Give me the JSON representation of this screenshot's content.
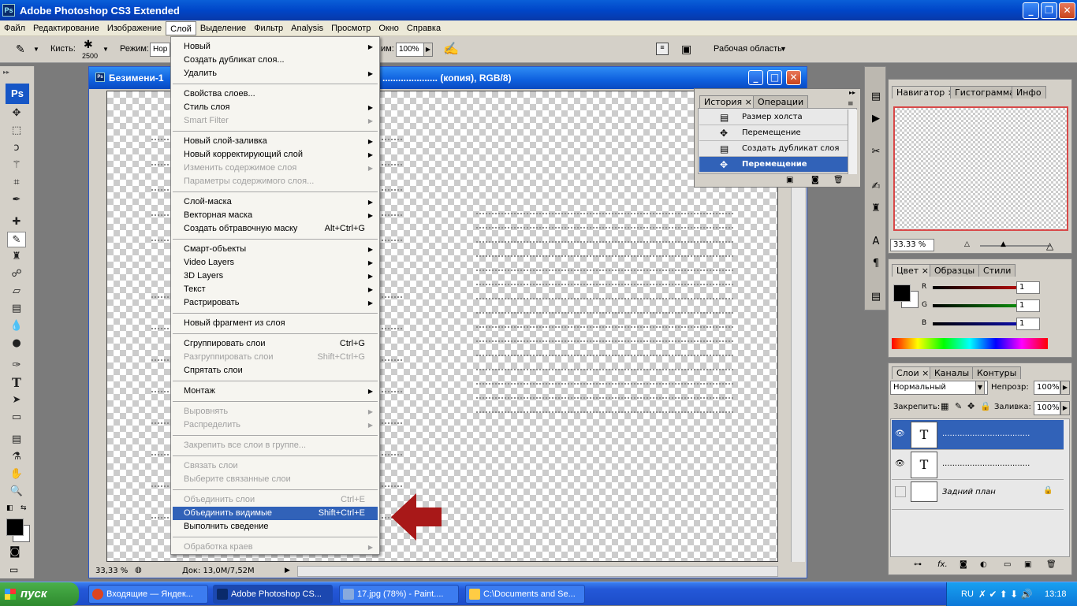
{
  "app": {
    "title": "Adobe Photoshop CS3 Extended",
    "icon": "Ps"
  },
  "menubar": [
    "Файл",
    "Редактирование",
    "Изображение",
    "Слой",
    "Выделение",
    "Фильтр",
    "Analysis",
    "Просмотр",
    "Окно",
    "Справка"
  ],
  "options": {
    "brush_label": "Кисть:",
    "brush_size": "2500",
    "mode_label": "Режим:",
    "mode_value": "Нор",
    "flow_suffix": "им:",
    "zoom_value": "100%",
    "workspace": "Рабочая область"
  },
  "document": {
    "title_left": "Безимени-1",
    "title_right": "..................... (копия), RGB/8)",
    "zoom": "33,33 %",
    "doc_size": "Док: 13,0M/7,52M"
  },
  "layer_menu": [
    {
      "label": "Новый",
      "sub": true
    },
    {
      "label": "Создать дубликат слоя..."
    },
    {
      "label": "Удалить",
      "sub": true
    },
    {
      "sep": true
    },
    {
      "label": "Свойства слоев..."
    },
    {
      "label": "Стиль слоя",
      "sub": true
    },
    {
      "label": "Smart Filter",
      "sub": true,
      "disabled": true
    },
    {
      "sep": true
    },
    {
      "label": "Новый слой-заливка",
      "sub": true
    },
    {
      "label": "Новый корректирующий слой",
      "sub": true
    },
    {
      "label": "Изменить содержимое слоя",
      "sub": true,
      "disabled": true
    },
    {
      "label": "Параметры содержимого слоя...",
      "disabled": true
    },
    {
      "sep": true
    },
    {
      "label": "Слой-маска",
      "sub": true
    },
    {
      "label": "Векторная маска",
      "sub": true
    },
    {
      "label": "Создать обтравочную маску",
      "shortcut": "Alt+Ctrl+G"
    },
    {
      "sep": true
    },
    {
      "label": "Смарт-объекты",
      "sub": true
    },
    {
      "label": "Video Layers",
      "sub": true
    },
    {
      "label": "3D Layers",
      "sub": true
    },
    {
      "label": "Текст",
      "sub": true
    },
    {
      "label": "Растрировать",
      "sub": true
    },
    {
      "sep": true
    },
    {
      "label": "Новый фрагмент из слоя"
    },
    {
      "sep": true
    },
    {
      "label": "Сгруппировать слои",
      "shortcut": "Ctrl+G"
    },
    {
      "label": "Разгруппировать слои",
      "shortcut": "Shift+Ctrl+G",
      "disabled": true
    },
    {
      "label": "Спрятать слои"
    },
    {
      "sep": true
    },
    {
      "label": "Монтаж",
      "sub": true
    },
    {
      "sep": true
    },
    {
      "label": "Выровнять",
      "sub": true,
      "disabled": true
    },
    {
      "label": "Распределить",
      "sub": true,
      "disabled": true
    },
    {
      "sep": true
    },
    {
      "label": "Закрепить все слои в группе...",
      "disabled": true
    },
    {
      "sep": true
    },
    {
      "label": "Связать слои",
      "disabled": true
    },
    {
      "label": "Выберите связанные слои",
      "disabled": true
    },
    {
      "sep": true
    },
    {
      "label": "Объединить слои",
      "shortcut": "Ctrl+E",
      "disabled": true
    },
    {
      "label": "Объединить видимые",
      "shortcut": "Shift+Ctrl+E",
      "highlighted": true
    },
    {
      "label": "Выполнить сведение"
    },
    {
      "sep": true
    },
    {
      "label": "Обработка краев",
      "sub": true,
      "disabled": true
    }
  ],
  "history": {
    "tabs": [
      "История",
      "Операции"
    ],
    "items": [
      "Размер холста",
      "Перемещение",
      "Создать дубликат слоя",
      "Перемещение"
    ],
    "selected_index": 3
  },
  "navigator": {
    "tabs": [
      "Навигатор",
      "Гистограмма",
      "Инфо"
    ],
    "zoom": "33.33 %"
  },
  "color": {
    "tabs": [
      "Цвет",
      "Образцы",
      "Стили"
    ],
    "channels": [
      {
        "name": "R",
        "value": "1",
        "color": "#e01010"
      },
      {
        "name": "G",
        "value": "1",
        "color": "#10b010"
      },
      {
        "name": "B",
        "value": "1",
        "color": "#1010d0"
      }
    ]
  },
  "layers": {
    "tabs": [
      "Слои",
      "Каналы",
      "Контуры"
    ],
    "blend_mode": "Нормальный",
    "opacity_label": "Непрозр:",
    "opacity": "100%",
    "lock_label": "Закрепить:",
    "fill_label": "Заливка:",
    "fill": "100%",
    "items": [
      {
        "thumb": "T",
        "name": "...................................",
        "selected": true
      },
      {
        "thumb": "T",
        "name": "..................................."
      },
      {
        "thumb": "",
        "name": "Задний план"
      }
    ]
  },
  "taskbar": {
    "start": "пуск",
    "tasks": [
      "Входящие — Яндек...",
      "Adobe Photoshop CS...",
      "17.jpg (78%) - Paint....",
      "C:\\Documents and Se..."
    ],
    "active_index": 1,
    "lang": "RU",
    "time": "13:18"
  }
}
